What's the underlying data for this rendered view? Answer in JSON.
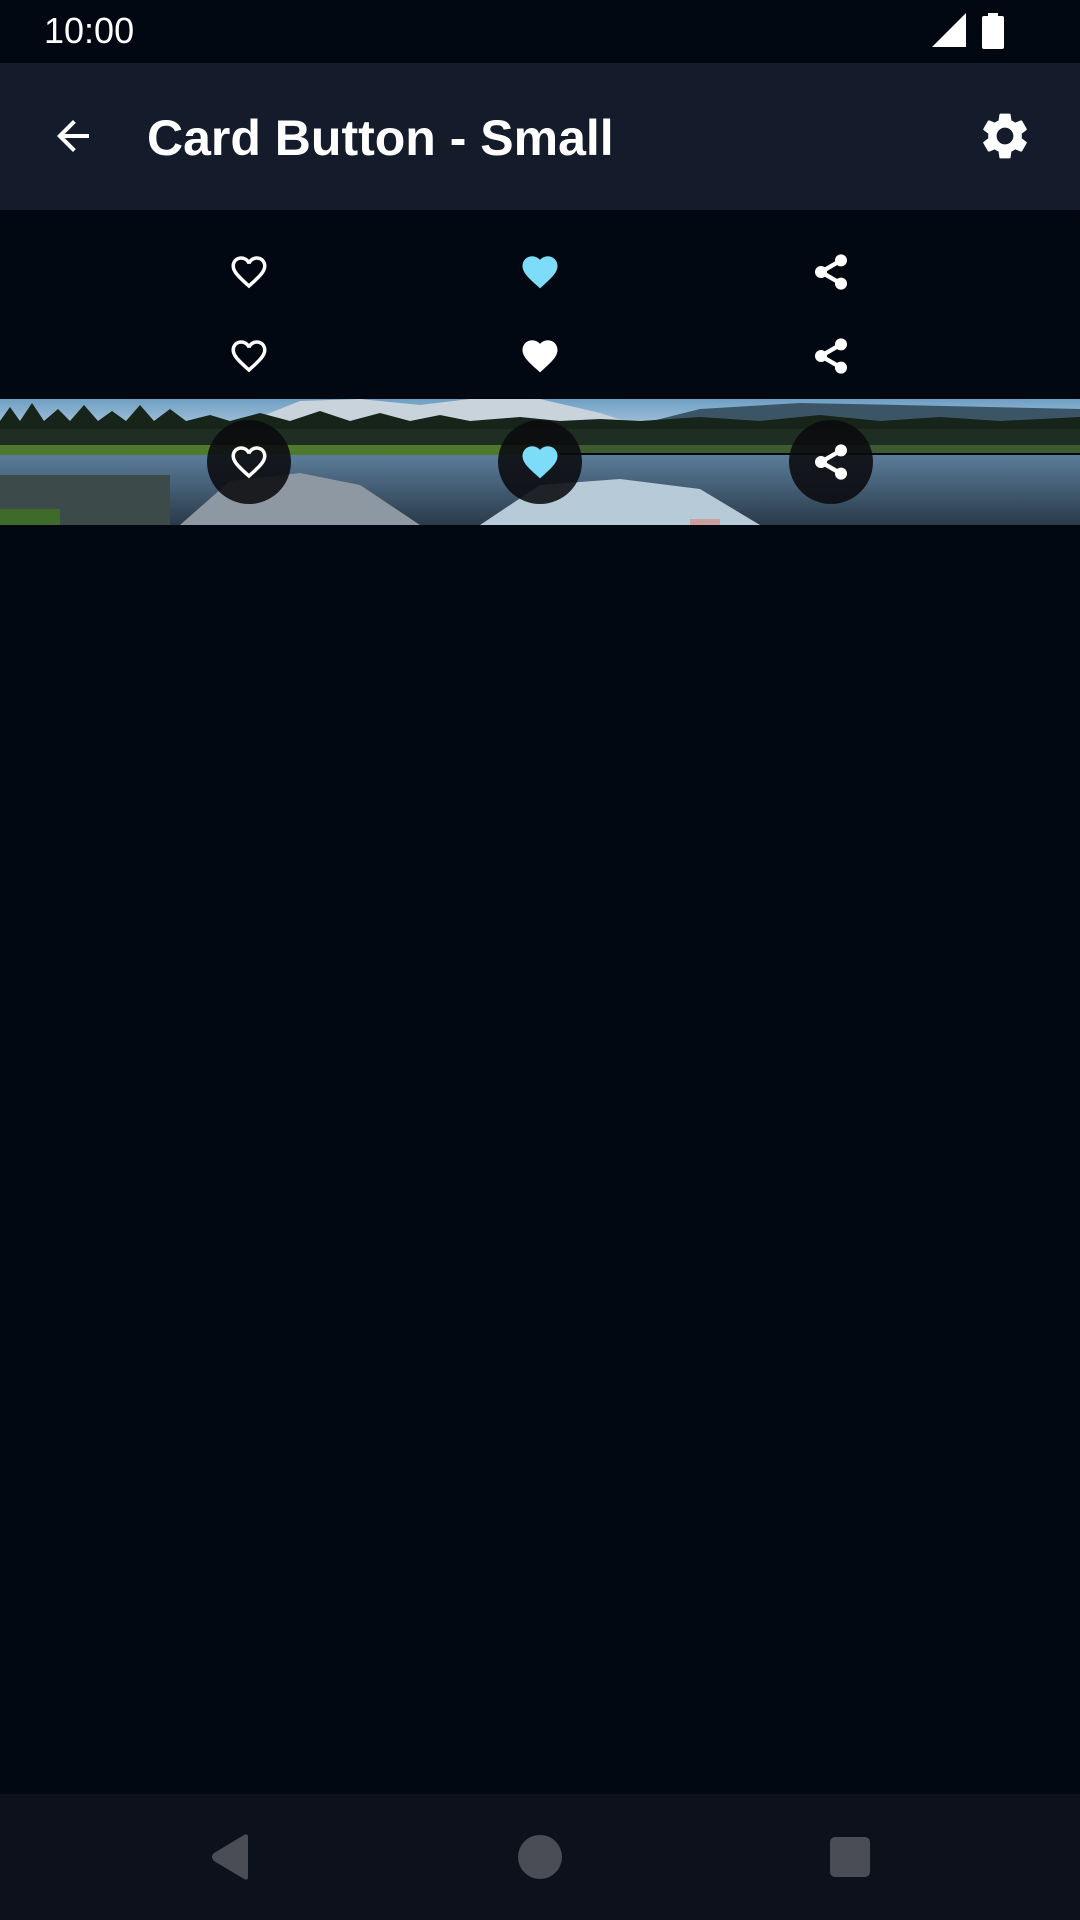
{
  "status_bar": {
    "time": "10:00",
    "signal_icon": "signal-icon",
    "battery_icon": "battery-icon"
  },
  "app_bar": {
    "title": "Card Button - Small",
    "back_icon": "arrow-back-icon",
    "settings_icon": "gear-icon"
  },
  "rows": [
    {
      "variant": "plain",
      "buttons": [
        {
          "icon": "heart-outline-icon",
          "selected": false
        },
        {
          "icon": "heart-filled-icon",
          "selected": true,
          "color": "#7ddcf7"
        },
        {
          "icon": "share-icon",
          "selected": false
        }
      ]
    },
    {
      "variant": "plain",
      "buttons": [
        {
          "icon": "heart-outline-icon",
          "selected": false
        },
        {
          "icon": "heart-filled-icon",
          "selected": true,
          "color": "#ffffff"
        },
        {
          "icon": "share-icon",
          "selected": false
        }
      ]
    },
    {
      "variant": "over-image",
      "buttons": [
        {
          "icon": "heart-outline-icon",
          "selected": false
        },
        {
          "icon": "heart-filled-icon",
          "selected": true,
          "color": "#7ddcf7"
        },
        {
          "icon": "share-icon",
          "selected": false
        }
      ]
    }
  ],
  "colors": {
    "background": "#020812",
    "app_bar": "#141c2b",
    "accent": "#7ddcf7",
    "nav_bar": "#0d111b"
  },
  "nav_bar": {
    "back_icon": "nav-back-icon",
    "home_icon": "nav-home-icon",
    "recents_icon": "nav-recents-icon"
  }
}
